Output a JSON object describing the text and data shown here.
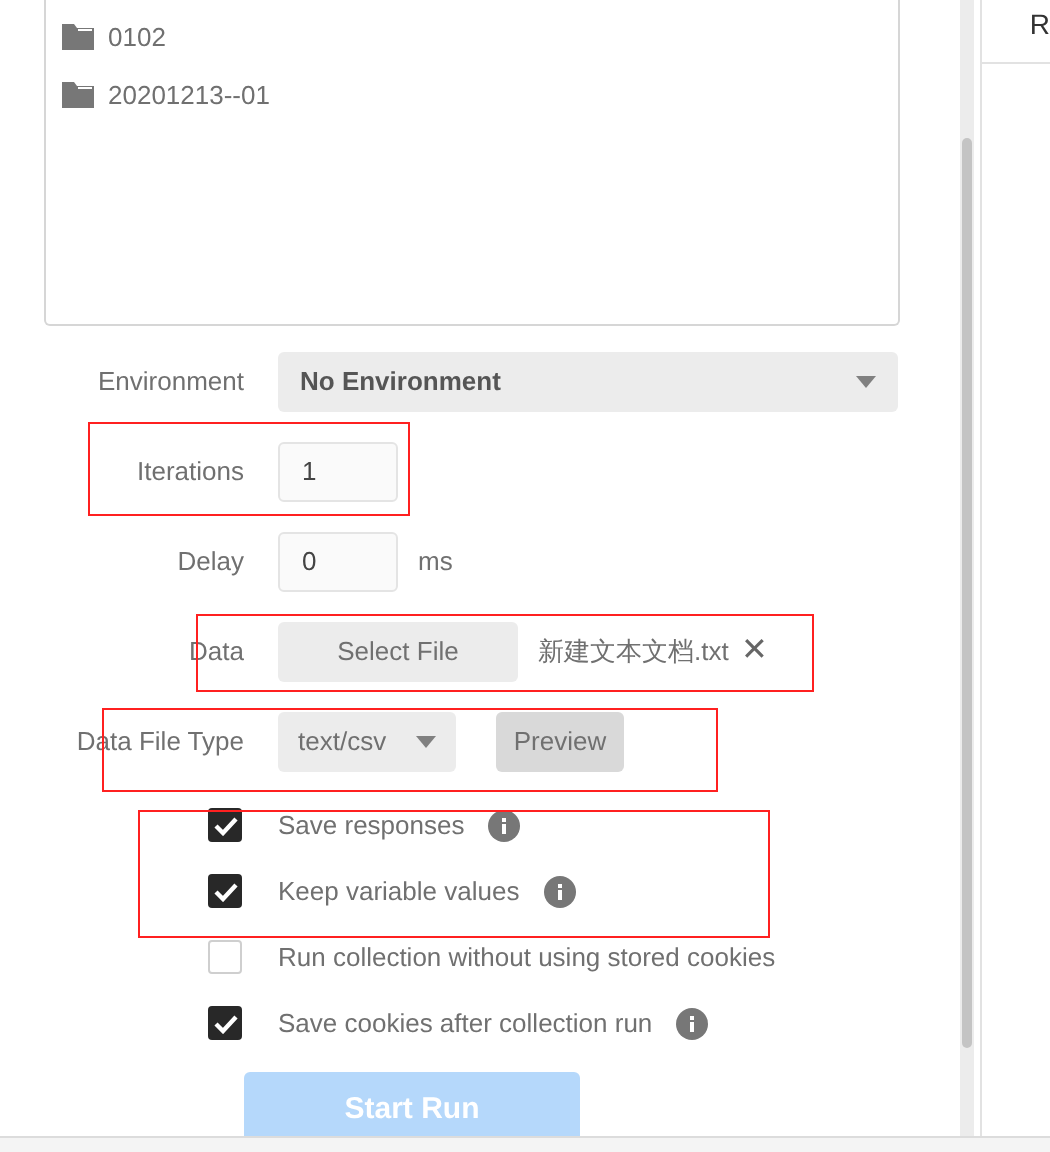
{
  "folders": [
    {
      "name": "0102"
    },
    {
      "name": "20201213--01"
    }
  ],
  "environment": {
    "label": "Environment",
    "value": "No Environment"
  },
  "iterations": {
    "label": "Iterations",
    "value": "1"
  },
  "delay": {
    "label": "Delay",
    "value": "0",
    "unit": "ms"
  },
  "data": {
    "label": "Data",
    "button": "Select File",
    "file": "新建文本文档.txt",
    "remove": "✕"
  },
  "data_file_type": {
    "label": "Data File Type",
    "value": "text/csv",
    "preview": "Preview"
  },
  "options": [
    {
      "label": "Save responses",
      "checked": true,
      "info": true
    },
    {
      "label": "Keep variable values",
      "checked": true,
      "info": true
    },
    {
      "label": "Run collection without using stored cookies",
      "checked": false,
      "info": false
    },
    {
      "label": "Save cookies after collection run",
      "checked": true,
      "info": true
    }
  ],
  "start_button": "Start Run",
  "right_panel": {
    "column_1": "R"
  }
}
